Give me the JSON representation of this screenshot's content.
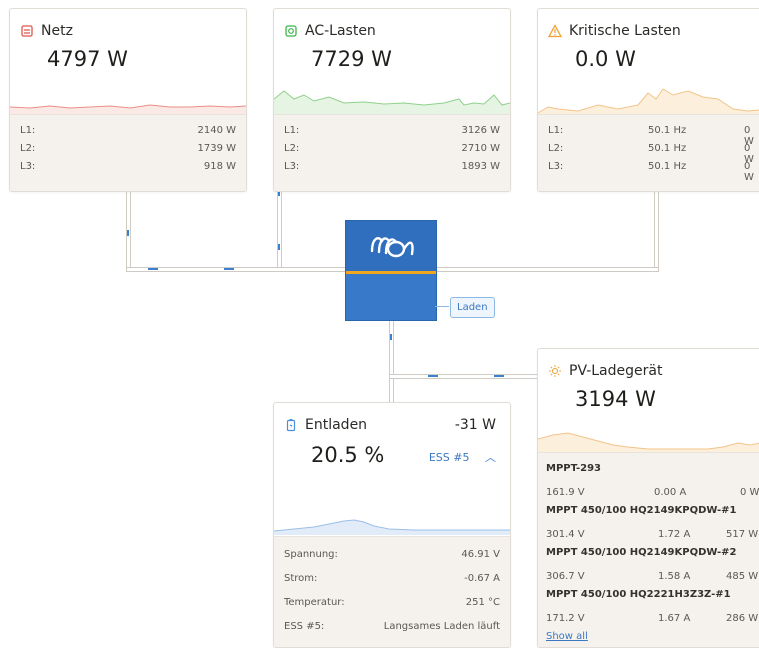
{
  "colors": {
    "accent": "#3a78c2",
    "grid": "#e0554a",
    "ac": "#3bb54a",
    "crit": "#f0a030",
    "battery": "#4a8fdc",
    "pv": "#f0a030"
  },
  "grid": {
    "icon": "grid-meter-icon",
    "title": "Netz",
    "value": "4797 W",
    "rows": [
      {
        "label": "L1:",
        "value": "2140 W"
      },
      {
        "label": "L2:",
        "value": "1739 W"
      },
      {
        "label": "L3:",
        "value": "918 W"
      }
    ]
  },
  "ac_loads": {
    "icon": "ac-plug-icon",
    "title": "AC-Lasten",
    "value": "7729 W",
    "rows": [
      {
        "label": "L1:",
        "value": "3126 W"
      },
      {
        "label": "L2:",
        "value": "2710 W"
      },
      {
        "label": "L3:",
        "value": "1893 W"
      }
    ]
  },
  "critical_loads": {
    "icon": "warning-triangle-icon",
    "title": "Kritische Lasten",
    "value": "0.0 W",
    "rows": [
      {
        "label": "L1:",
        "freq": "50.1 Hz",
        "value": "0 W"
      },
      {
        "label": "L2:",
        "freq": "50.1 Hz",
        "value": "0 W"
      },
      {
        "label": "L3:",
        "freq": "50.1 Hz",
        "value": "0 W"
      }
    ]
  },
  "inverter": {
    "badge": "Laden",
    "logo": "victron-logo"
  },
  "battery": {
    "icon": "battery-icon",
    "title": "Entladen",
    "power": "-31 W",
    "soc": "20.5 %",
    "selector": "ESS #5",
    "rows": [
      {
        "label": "Spannung:",
        "value": "46.91 V"
      },
      {
        "label": "Strom:",
        "value": "-0.67 A"
      },
      {
        "label": "Temperatur:",
        "value": "251 °C"
      },
      {
        "label": "ESS #5:",
        "value": "Langsames Laden läuft"
      }
    ]
  },
  "pv": {
    "icon": "sun-icon",
    "title": "PV-Ladegerät",
    "value": "3194 W",
    "chargers": [
      {
        "name": "MPPT-293",
        "voltage": "161.9 V",
        "current": "0.00 A",
        "power": "0 W"
      },
      {
        "name": "MPPT 450/100 HQ2149KPQDW-#1",
        "voltage": "301.4 V",
        "current": "1.72 A",
        "power": "517 W"
      },
      {
        "name": "MPPT 450/100 HQ2149KPQDW-#2",
        "voltage": "306.7 V",
        "current": "1.58 A",
        "power": "485 W"
      },
      {
        "name": "MPPT 450/100 HQ2221H3Z3Z-#1",
        "voltage": "171.2 V",
        "current": "1.67 A",
        "power": "286 W"
      }
    ],
    "show_all": "Show all"
  }
}
